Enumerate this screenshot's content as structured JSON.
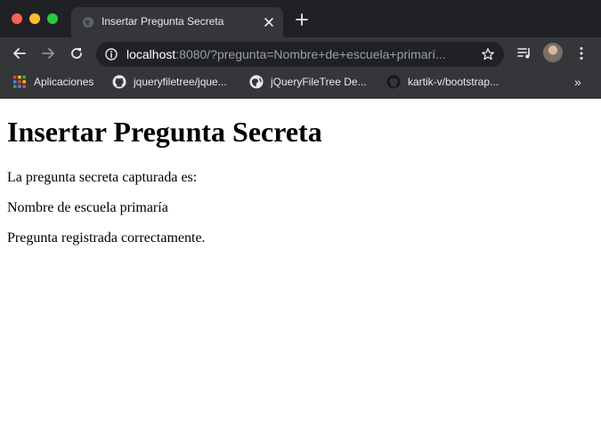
{
  "window": {
    "controls": [
      "close",
      "minimize",
      "maximize"
    ],
    "colors": {
      "close": "#ff5f57",
      "minimize": "#febc2e",
      "maximize": "#28c840"
    }
  },
  "tab": {
    "title": "Insertar Pregunta Secreta",
    "favicon": "globe-icon"
  },
  "toolbar": {
    "url_host": "localhost",
    "url_rest": ":8080/?pregunta=Nombre+de+escuela+primarí..."
  },
  "bookmarks": [
    {
      "label": "Aplicaciones",
      "icon": "apps-grid-icon"
    },
    {
      "label": "jqueryfiletree/jque...",
      "icon": "github-icon"
    },
    {
      "label": "jQueryFileTree De...",
      "icon": "globe-icon"
    },
    {
      "label": "kartik-v/bootstrap...",
      "icon": "github-icon"
    }
  ],
  "bookmarks_overflow": "»",
  "page": {
    "heading": "Insertar Pregunta Secreta",
    "intro": "La pregunta secreta capturada es:",
    "question": "Nombre de escuela primaría",
    "status": "Pregunta registrada correctamente."
  }
}
